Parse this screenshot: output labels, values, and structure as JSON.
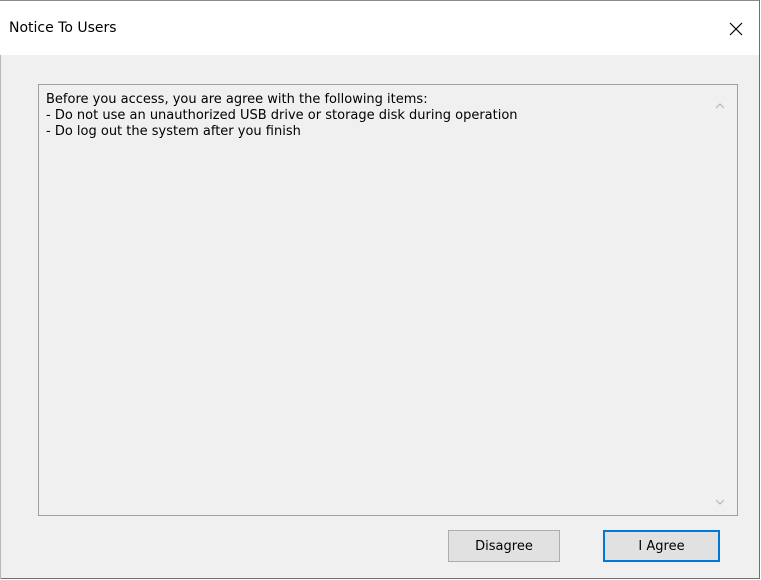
{
  "window": {
    "title": "Notice To Users",
    "close_icon": "close-icon"
  },
  "notice": {
    "lines": [
      "Before you access, you are agree with the following items:",
      "- Do not use an unauthorized USB drive or storage disk during operation",
      "- Do log out the system after you finish"
    ],
    "scroll_up_icon": "chevron-up-icon",
    "scroll_down_icon": "chevron-down-icon"
  },
  "buttons": {
    "disagree_label": "Disagree",
    "agree_label": "I Agree"
  },
  "colors": {
    "dialog_background": "#f0f0f0",
    "titlebar_background": "#ffffff",
    "button_background": "#e1e1e1",
    "default_button_border": "#0078d7"
  }
}
